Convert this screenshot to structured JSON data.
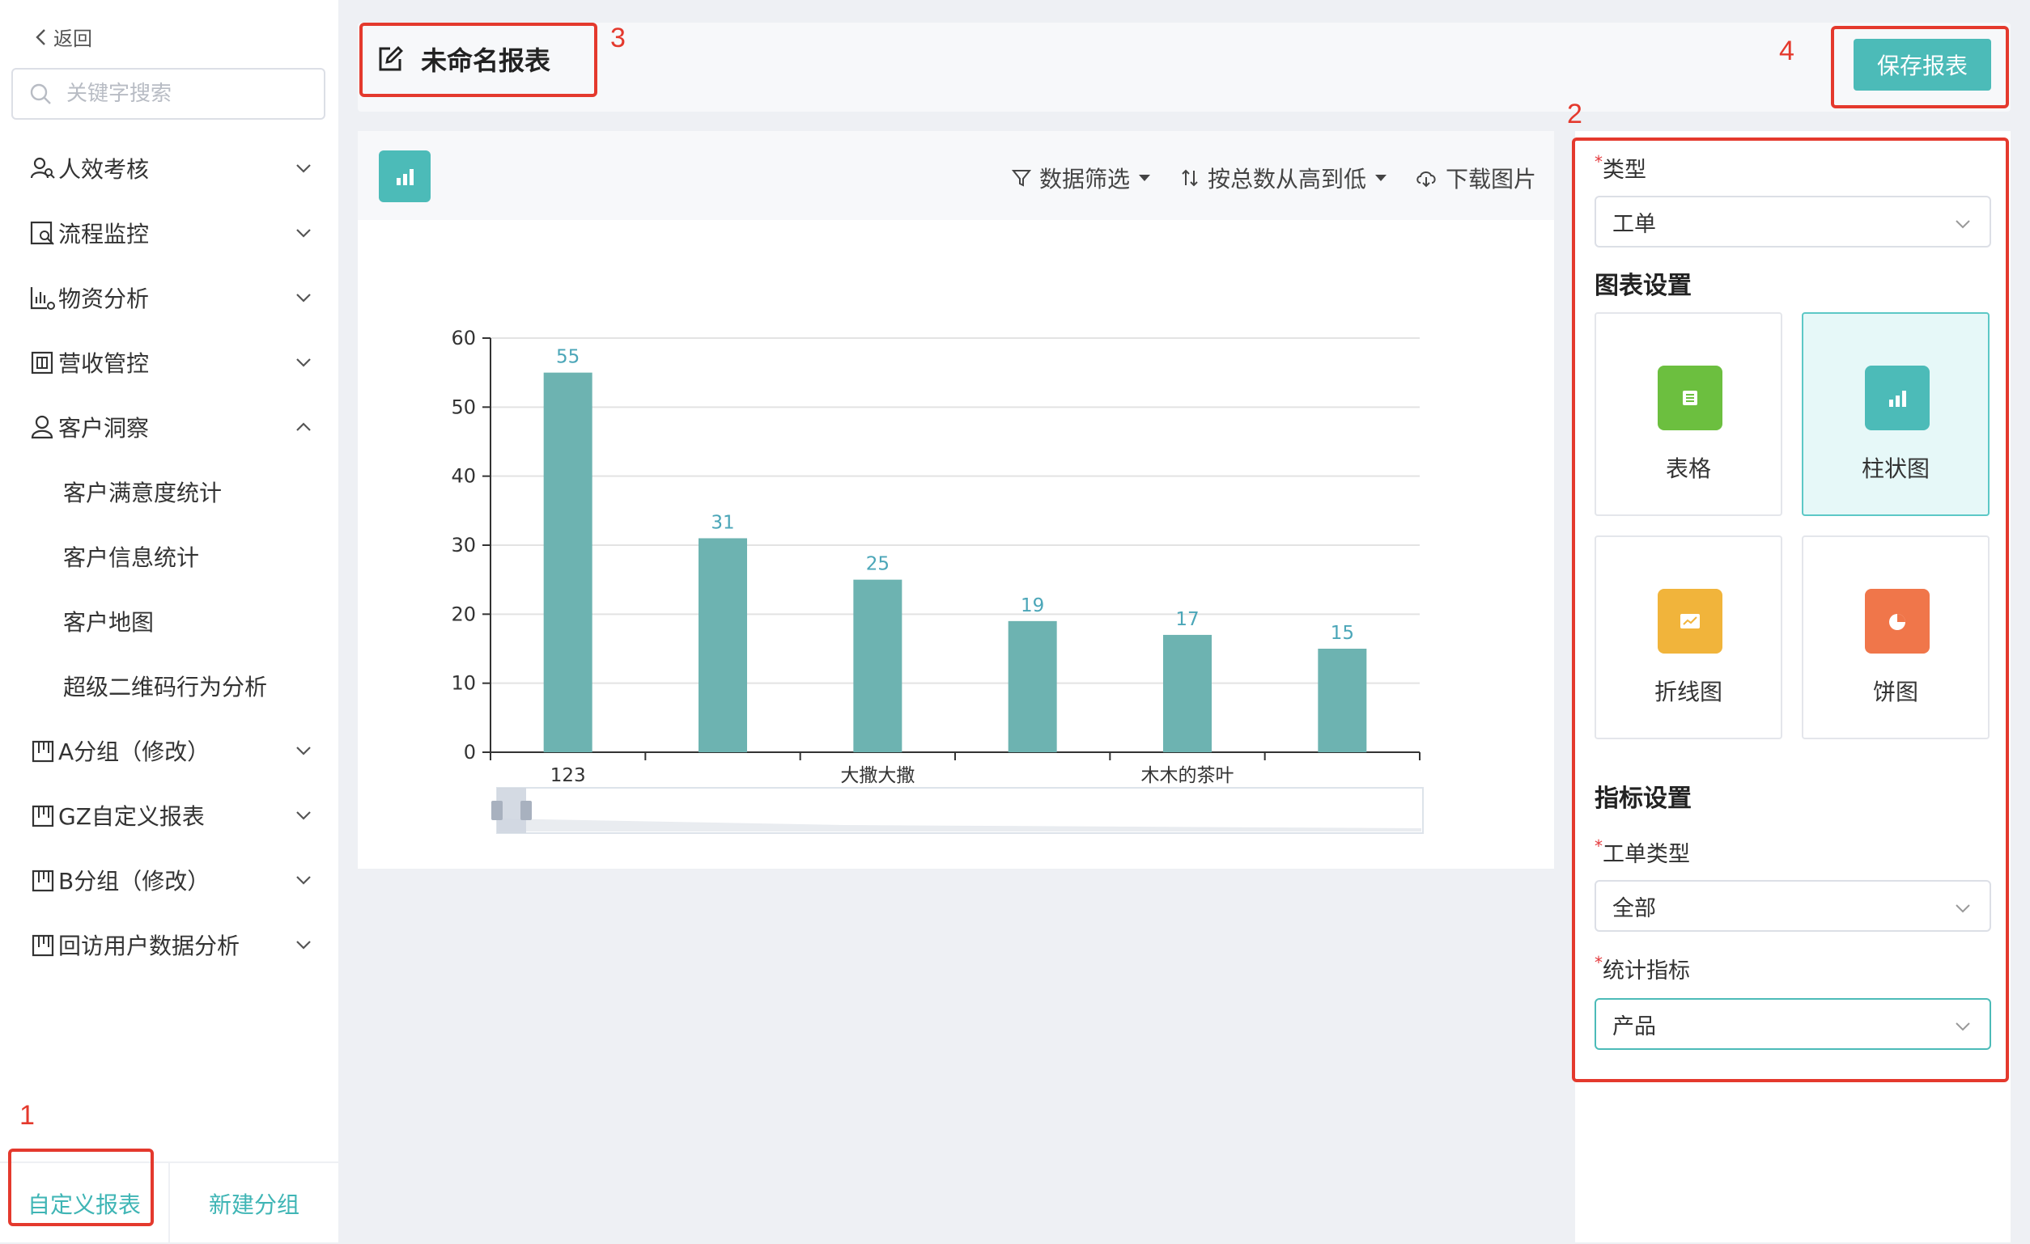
{
  "sidebar": {
    "back_label": "返回",
    "search_placeholder": "关键字搜索",
    "menu": [
      {
        "label": "人效考核",
        "icon": "people-search-icon"
      },
      {
        "label": "流程监控",
        "icon": "process-monitor-icon"
      },
      {
        "label": "物资分析",
        "icon": "material-chart-icon"
      },
      {
        "label": "营收管控",
        "icon": "revenue-icon"
      },
      {
        "label": "客户洞察",
        "icon": "customer-icon",
        "expanded": true,
        "children": [
          "客户满意度统计",
          "客户信息统计",
          "客户地图",
          "超级二维码行为分析"
        ]
      },
      {
        "label": "A分组（修改）",
        "icon": "group-icon"
      },
      {
        "label": "GZ自定义报表",
        "icon": "group-icon"
      },
      {
        "label": "B分组（修改）",
        "icon": "group-icon"
      },
      {
        "label": "回访用户数据分析",
        "icon": "group-icon"
      }
    ],
    "footer": {
      "custom_report": "自定义报表",
      "new_group": "新建分组"
    }
  },
  "header": {
    "title": "未命名报表",
    "save_label": "保存报表"
  },
  "toolbar": {
    "filter_label": "数据筛选",
    "sort_label": "按总数从高到低",
    "download_label": "下载图片"
  },
  "chart_data": {
    "type": "bar",
    "categories": [
      "123",
      "",
      "大撒大撒",
      "",
      "木木的茶叶",
      ""
    ],
    "values": [
      55,
      31,
      25,
      19,
      17,
      15
    ],
    "ylim": [
      0,
      60
    ],
    "yticks": [
      0,
      10,
      20,
      30,
      40,
      50,
      60
    ],
    "bar_color": "#6db3b1",
    "label_color": "#4ba6b8",
    "grid": true,
    "datazoom": true
  },
  "settings": {
    "type_label": "类型",
    "type_value": "工单",
    "chart_section": "图表设置",
    "chart_types": [
      {
        "label": "表格",
        "icon": "table-icon",
        "color": "#6cbf3f"
      },
      {
        "label": "柱状图",
        "icon": "bar-chart-icon",
        "color": "#4cbbb8",
        "selected": true
      },
      {
        "label": "折线图",
        "icon": "line-chart-icon",
        "color": "#f1b43b"
      },
      {
        "label": "饼图",
        "icon": "pie-chart-icon",
        "color": "#f0764a"
      }
    ],
    "metric_section": "指标设置",
    "order_type_label": "工单类型",
    "order_type_value": "全部",
    "stat_label": "统计指标",
    "stat_value": "产品"
  },
  "annotations": [
    "1",
    "2",
    "3",
    "4"
  ],
  "colors": {
    "accent": "#4cbbb8",
    "annotation": "#e4392d"
  }
}
